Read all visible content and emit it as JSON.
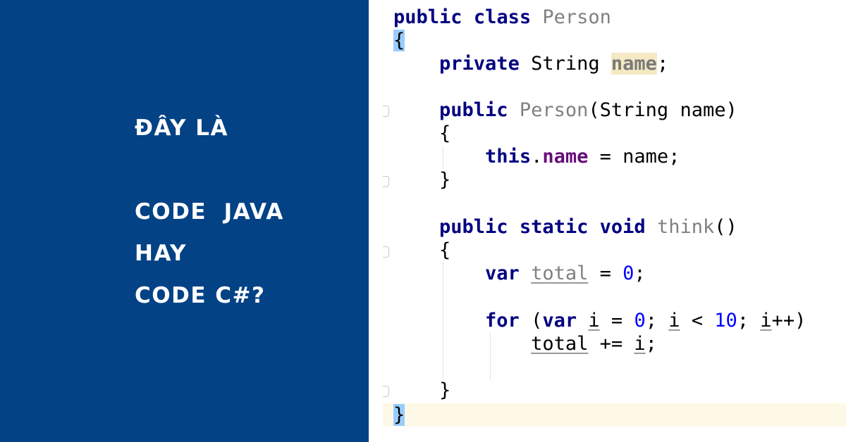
{
  "headline": {
    "line1": "ĐÂY LÀ",
    "line2": "CODE  JAVA",
    "line3": "HAY",
    "line4": "CODE C#?"
  },
  "colors": {
    "panel_background": "#044286",
    "keyword": "#000080",
    "class_name": "#808080",
    "field": "#660e7a",
    "number": "#0000ff",
    "brace_highlight": "#99ccff",
    "current_line": "#fef8e6"
  },
  "code": {
    "language": "C#/Java",
    "lines": [
      "public class Person",
      "{",
      "    private String name;",
      "",
      "    public Person(String name)",
      "    {",
      "        this.name = name;",
      "    }",
      "",
      "    public static void think()",
      "    {",
      "        var total = 0;",
      "",
      "        for (var i = 0; i < 10; i++)",
      "            total += i;",
      "",
      "    }",
      "}"
    ],
    "tokens": {
      "public": "public",
      "class": "class",
      "private": "private",
      "static": "static",
      "void": "void",
      "this": "this",
      "var": "var",
      "for": "for",
      "Person": "Person",
      "String": "String",
      "name": "name",
      "think": "think",
      "total": "total",
      "i": "i",
      "zero": "0",
      "ten": "10",
      "open_brace": "{",
      "close_brace": "}"
    }
  }
}
